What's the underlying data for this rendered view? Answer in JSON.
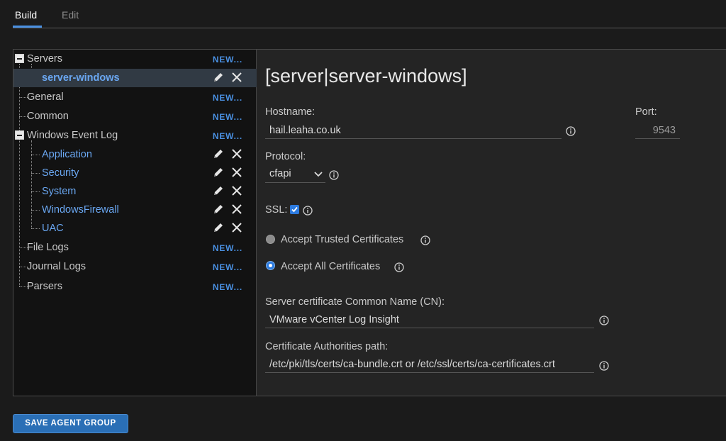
{
  "tabs": [
    {
      "label": "Build",
      "active": true
    },
    {
      "label": "Edit",
      "active": false
    }
  ],
  "tree": {
    "new_label": "NEW...",
    "servers": {
      "label": "Servers",
      "children": [
        {
          "label": "server-windows",
          "selected": true
        }
      ]
    },
    "general": {
      "label": "General"
    },
    "common": {
      "label": "Common"
    },
    "windows_event_log": {
      "label": "Windows Event Log",
      "children": [
        {
          "label": "Application"
        },
        {
          "label": "Security"
        },
        {
          "label": "System"
        },
        {
          "label": "WindowsFirewall"
        },
        {
          "label": "UAC"
        }
      ]
    },
    "file_logs": {
      "label": "File Logs"
    },
    "journal_logs": {
      "label": "Journal Logs"
    },
    "parsers": {
      "label": "Parsers"
    }
  },
  "form": {
    "heading": "[server|server-windows]",
    "hostname_label": "Hostname:",
    "hostname_value": "hail.leaha.co.uk",
    "port_label": "Port:",
    "port_value": "9543",
    "protocol_label": "Protocol:",
    "protocol_value": "cfapi",
    "ssl_label": "SSL:",
    "ssl_checked": true,
    "accept_trusted_label": "Accept Trusted Certificates",
    "accept_all_label": "Accept All Certificates",
    "cn_label": "Server certificate Common Name (CN):",
    "cn_value": "VMware vCenter Log Insight",
    "ca_path_label": "Certificate Authorities path:",
    "ca_path_value": "/etc/pki/tls/certs/ca-bundle.crt or /etc/ssl/certs/ca-certificates.crt"
  },
  "footer": {
    "save_label": "SAVE AGENT GROUP"
  },
  "colors": {
    "accent": "#4a90e2",
    "link": "#6aa7f2",
    "button": "#2a6fb6"
  }
}
